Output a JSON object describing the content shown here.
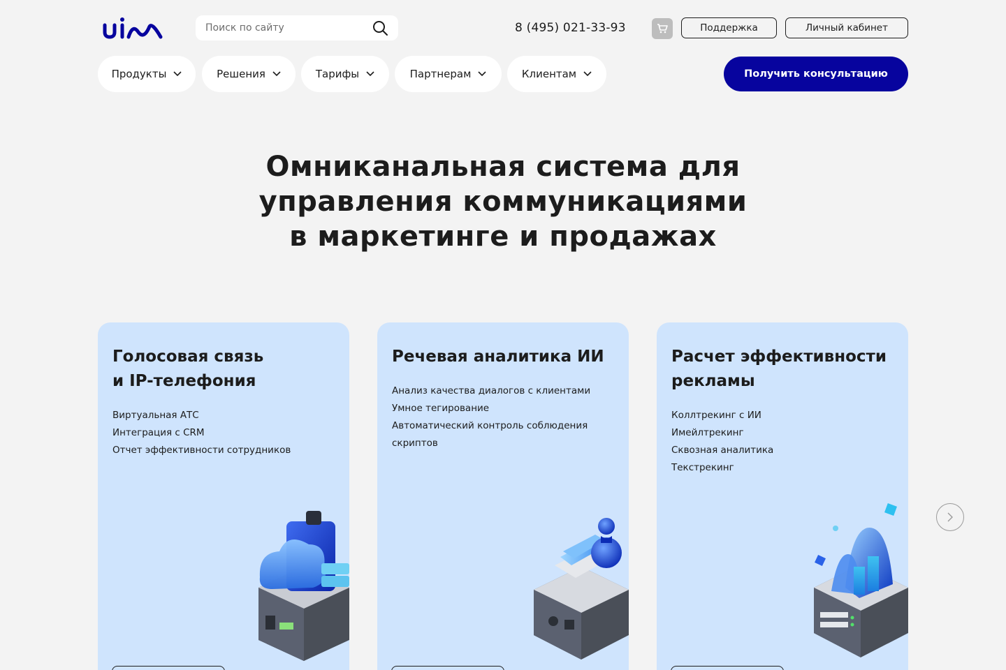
{
  "header": {
    "search_placeholder": "Поиск по сайту",
    "phone": "8 (495) 021-33-93",
    "support_label": "Поддержка",
    "cabinet_label": "Личный кабинет"
  },
  "nav": {
    "items": [
      {
        "label": "Продукты"
      },
      {
        "label": "Решения"
      },
      {
        "label": "Тарифы"
      },
      {
        "label": "Партнерам"
      },
      {
        "label": "Клиентам"
      }
    ],
    "cta_label": "Получить консультацию"
  },
  "hero": {
    "lines": [
      "Омниканальная система для",
      "управления коммуникациями",
      "в маркетинге и продажах"
    ]
  },
  "cards": [
    {
      "title_lines": [
        "Голосовая связь",
        "и IP-телефония"
      ],
      "items": [
        "Виртуальная АТС",
        "Интеграция с CRM",
        "Отчет эффективности сотрудников"
      ]
    },
    {
      "title_lines": [
        "Речевая аналитика ИИ"
      ],
      "items": [
        "Анализ качества диалогов с клиентами",
        "Умное тегирование",
        "Автоматический контроль соблюдения",
        "скриптов"
      ]
    },
    {
      "title_lines": [
        "Расчет эффективности",
        "рекламы"
      ],
      "items": [
        "Коллтрекинг с ИИ",
        "Имейлтрекинг",
        "Сквозная аналитика",
        "Текстрекинг"
      ]
    }
  ],
  "colors": {
    "brand": "#07049e",
    "card_bg": "#cfe4fd",
    "page_bg": "#f3f3f3"
  },
  "icons": {
    "search": "search-icon",
    "cart": "cart-icon",
    "chevron": "chevron-down-icon",
    "next": "chevron-right-icon"
  }
}
